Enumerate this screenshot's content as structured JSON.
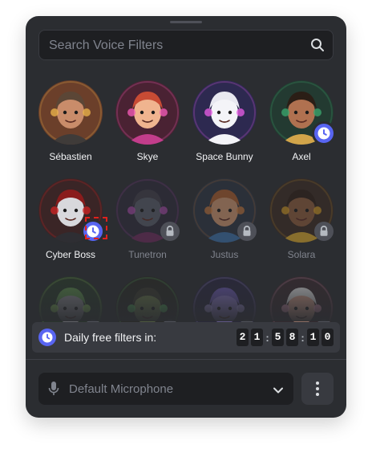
{
  "search": {
    "placeholder": "Search Voice Filters",
    "icon": "search-icon"
  },
  "filters": [
    {
      "name": "Sébastien",
      "locked": false,
      "timed": false,
      "colors": {
        "bg": "#6b3f2a",
        "face": "#c98c6a",
        "hair": "#5b4636",
        "shirt": "#3f3b39",
        "accent": "#e8b04a"
      }
    },
    {
      "name": "Skye",
      "locked": false,
      "timed": false,
      "colors": {
        "bg": "#4a2233",
        "face": "#f0b48f",
        "hair": "#c84b34",
        "shirt": "#c23d8b",
        "accent": "#f05ab4"
      }
    },
    {
      "name": "Space Bunny",
      "locked": false,
      "timed": false,
      "colors": {
        "bg": "#2d2950",
        "face": "#f4f4f8",
        "hair": "#e8e8f0",
        "shirt": "#f4f4f8",
        "accent": "#e05adf"
      }
    },
    {
      "name": "Axel",
      "locked": false,
      "timed": true,
      "colors": {
        "bg": "#233a31",
        "face": "#b07150",
        "hair": "#2b1e16",
        "shirt": "#d2a54a",
        "accent": "#3aa36b"
      }
    },
    {
      "name": "Cyber Boss",
      "locked": false,
      "timed": true,
      "colors": {
        "bg": "#3a2526",
        "face": "#d8d8dc",
        "hair": "#8a1c1c",
        "shirt": "#2e2e33",
        "accent": "#c82323"
      }
    },
    {
      "name": "Tunetron",
      "locked": true,
      "timed": false,
      "colors": {
        "bg": "#2e2a3a",
        "face": "#555a66",
        "hair": "#3f3c48",
        "shirt": "#6a2a5a",
        "accent": "#b04ab0"
      }
    },
    {
      "name": "Justus",
      "locked": true,
      "timed": false,
      "colors": {
        "bg": "#2c3440",
        "face": "#c9926c",
        "hair": "#a55a2a",
        "shirt": "#3b6ea5",
        "accent": "#d07a3a"
      }
    },
    {
      "name": "Solara",
      "locked": true,
      "timed": false,
      "colors": {
        "bg": "#3a2a22",
        "face": "#8a5a3a",
        "hair": "#2d1d14",
        "shirt": "#d4a42a",
        "accent": "#e0a020"
      }
    },
    {
      "name": "",
      "locked": true,
      "timed": false,
      "colors": {
        "bg": "#2a3a2a",
        "face": "#8a8a90",
        "hair": "#5a8a4a",
        "shirt": "#c050b0",
        "accent": "#98d860"
      }
    },
    {
      "name": "",
      "locked": true,
      "timed": false,
      "colors": {
        "bg": "#2a2a26",
        "face": "#6a7a4a",
        "hair": "#3a3a30",
        "shirt": "#4a4a3a",
        "accent": "#58c060"
      }
    },
    {
      "name": "",
      "locked": true,
      "timed": false,
      "colors": {
        "bg": "#2a2640",
        "face": "#8a78c8",
        "hair": "#6a58b0",
        "shirt": "#7060c0",
        "accent": "#b0a0f0"
      }
    },
    {
      "name": "",
      "locked": true,
      "timed": false,
      "colors": {
        "bg": "#3a2a30",
        "face": "#d8a08a",
        "hair": "#e0e0e0",
        "shirt": "#b04060",
        "accent": "#f0a0c0"
      }
    }
  ],
  "daily": {
    "label": "Daily free filters in:",
    "digits": [
      "2",
      "1",
      ":",
      "5",
      "8",
      ":",
      "1",
      "0"
    ],
    "icon": "clock-icon"
  },
  "microphone": {
    "label": "Default Microphone",
    "icon": "microphone-icon",
    "dropdown_icon": "chevron-down-icon"
  },
  "more": {
    "icon": "more-vertical-icon"
  },
  "colors": {
    "panel": "#2b2d31",
    "accent": "#5865f2",
    "lock_badge": "#4e5058",
    "focus": "#e0201b"
  }
}
